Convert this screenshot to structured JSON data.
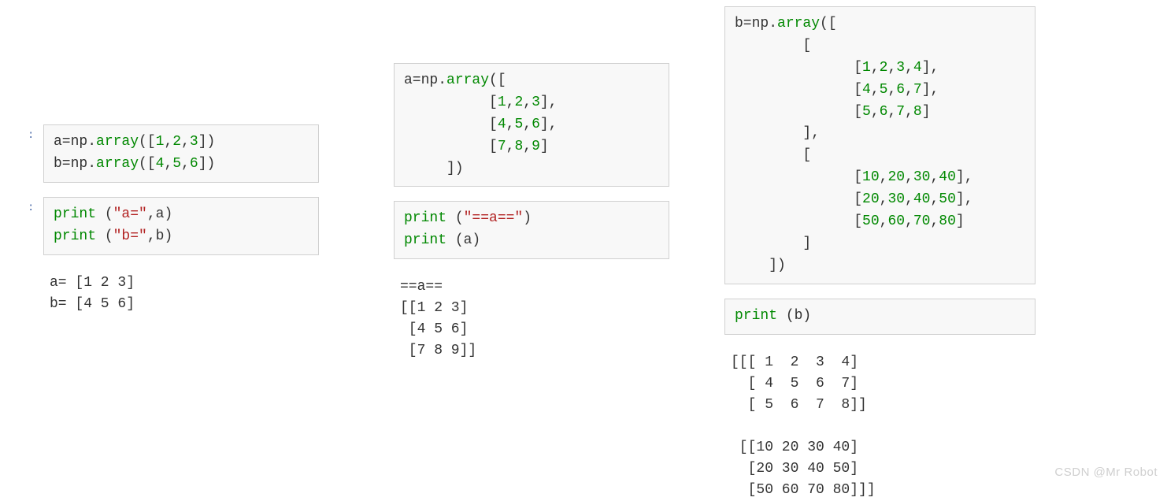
{
  "col1": {
    "cell1": {
      "prompt": ":",
      "code_html": "a=np.<span class='fn'>array</span>([<span class='num'>1</span>,<span class='num'>2</span>,<span class='num'>3</span>])\nb=np.<span class='fn'>array</span>([<span class='num'>4</span>,<span class='num'>5</span>,<span class='num'>6</span>])"
    },
    "cell2": {
      "prompt": ":",
      "code_html": "<span class='kw'>print</span> (<span class='str'>\"a=\"</span>,a)\n<span class='kw'>print</span> (<span class='str'>\"b=\"</span>,b)"
    },
    "out": "a= [1 2 3]\nb= [4 5 6]"
  },
  "col2": {
    "cell1": {
      "code_html": "a=np.<span class='fn'>array</span>([\n          [<span class='num'>1</span>,<span class='num'>2</span>,<span class='num'>3</span>],\n          [<span class='num'>4</span>,<span class='num'>5</span>,<span class='num'>6</span>],\n          [<span class='num'>7</span>,<span class='num'>8</span>,<span class='num'>9</span>]\n     ])"
    },
    "cell2": {
      "code_html": "<span class='kw'>print</span> (<span class='str'>\"==a==\"</span>)\n<span class='kw'>print</span> (a)"
    },
    "out": "==a==\n[[1 2 3]\n [4 5 6]\n [7 8 9]]"
  },
  "col3": {
    "cell1": {
      "code_html": "b=np.<span class='fn'>array</span>([\n        [\n              [<span class='num'>1</span>,<span class='num'>2</span>,<span class='num'>3</span>,<span class='num'>4</span>],\n              [<span class='num'>4</span>,<span class='num'>5</span>,<span class='num'>6</span>,<span class='num'>7</span>],\n              [<span class='num'>5</span>,<span class='num'>6</span>,<span class='num'>7</span>,<span class='num'>8</span>]\n        ],\n        [\n              [<span class='num'>10</span>,<span class='num'>20</span>,<span class='num'>30</span>,<span class='num'>40</span>],\n              [<span class='num'>20</span>,<span class='num'>30</span>,<span class='num'>40</span>,<span class='num'>50</span>],\n              [<span class='num'>50</span>,<span class='num'>60</span>,<span class='num'>70</span>,<span class='num'>80</span>]\n        ]\n    ])"
    },
    "cell2": {
      "code_html": "<span class='kw'>print</span> (b)"
    },
    "out": "[[[ 1  2  3  4]\n  [ 4  5  6  7]\n  [ 5  6  7  8]]\n\n [[10 20 30 40]\n  [20 30 40 50]\n  [50 60 70 80]]]"
  },
  "watermark": "CSDN @Mr Robot"
}
